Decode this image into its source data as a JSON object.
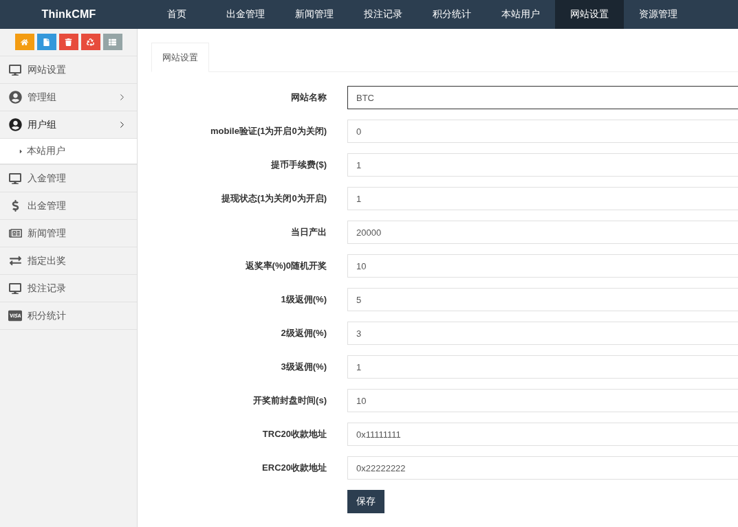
{
  "brand": "ThinkCMF",
  "top_nav": [
    {
      "label": "首页",
      "selected": false
    },
    {
      "label": "出金管理",
      "selected": false
    },
    {
      "label": "新闻管理",
      "selected": false
    },
    {
      "label": "投注记录",
      "selected": false
    },
    {
      "label": "积分统计",
      "selected": false
    },
    {
      "label": "本站用户",
      "selected": false
    },
    {
      "label": "网站设置",
      "selected": true
    },
    {
      "label": "资源管理",
      "selected": false
    }
  ],
  "sidebar": {
    "shortcuts": [
      {
        "color": "#f39c12"
      },
      {
        "color": "#3498db"
      },
      {
        "color": "#e74c3c"
      },
      {
        "color": "#e74c3c"
      },
      {
        "color": "#95a5a6"
      }
    ],
    "items": [
      {
        "label": "网站设置"
      },
      {
        "label": "管理组",
        "expanded": false
      },
      {
        "label": "用户组",
        "expanded": true,
        "children": [
          {
            "label": "本站用户"
          }
        ]
      },
      {
        "label": "入金管理"
      },
      {
        "label": "出金管理"
      },
      {
        "label": "新闻管理"
      },
      {
        "label": "指定出奖"
      },
      {
        "label": "投注记录"
      },
      {
        "label": "积分统计"
      }
    ]
  },
  "tabs": [
    {
      "label": "网站设置",
      "selected": true
    }
  ],
  "form": {
    "fields": [
      {
        "label": "网站名称",
        "value": "BTC",
        "focused": true
      },
      {
        "label": "mobile验证(1为开启0为关闭)",
        "value": "0",
        "focused": false
      },
      {
        "label": "提币手续费($)",
        "value": "1",
        "focused": false
      },
      {
        "label": "提现状态(1为关闭0为开启)",
        "value": "1",
        "focused": false
      },
      {
        "label": "当日产出",
        "value": "20000",
        "focused": false
      },
      {
        "label": "返奖率(%)0随机开奖",
        "value": "10",
        "focused": false
      },
      {
        "label": "1级返佣(%)",
        "value": "5",
        "focused": false
      },
      {
        "label": "2级返佣(%)",
        "value": "3",
        "focused": false
      },
      {
        "label": "3级返佣(%)",
        "value": "1",
        "focused": false
      },
      {
        "label": "开奖前封盘时间(s)",
        "value": "10",
        "focused": false
      },
      {
        "label": "TRC20收款地址",
        "value": "0x11111111",
        "focused": false
      },
      {
        "label": "ERC20收款地址",
        "value": "0x22222222",
        "focused": false
      }
    ],
    "save_button": "保存"
  }
}
